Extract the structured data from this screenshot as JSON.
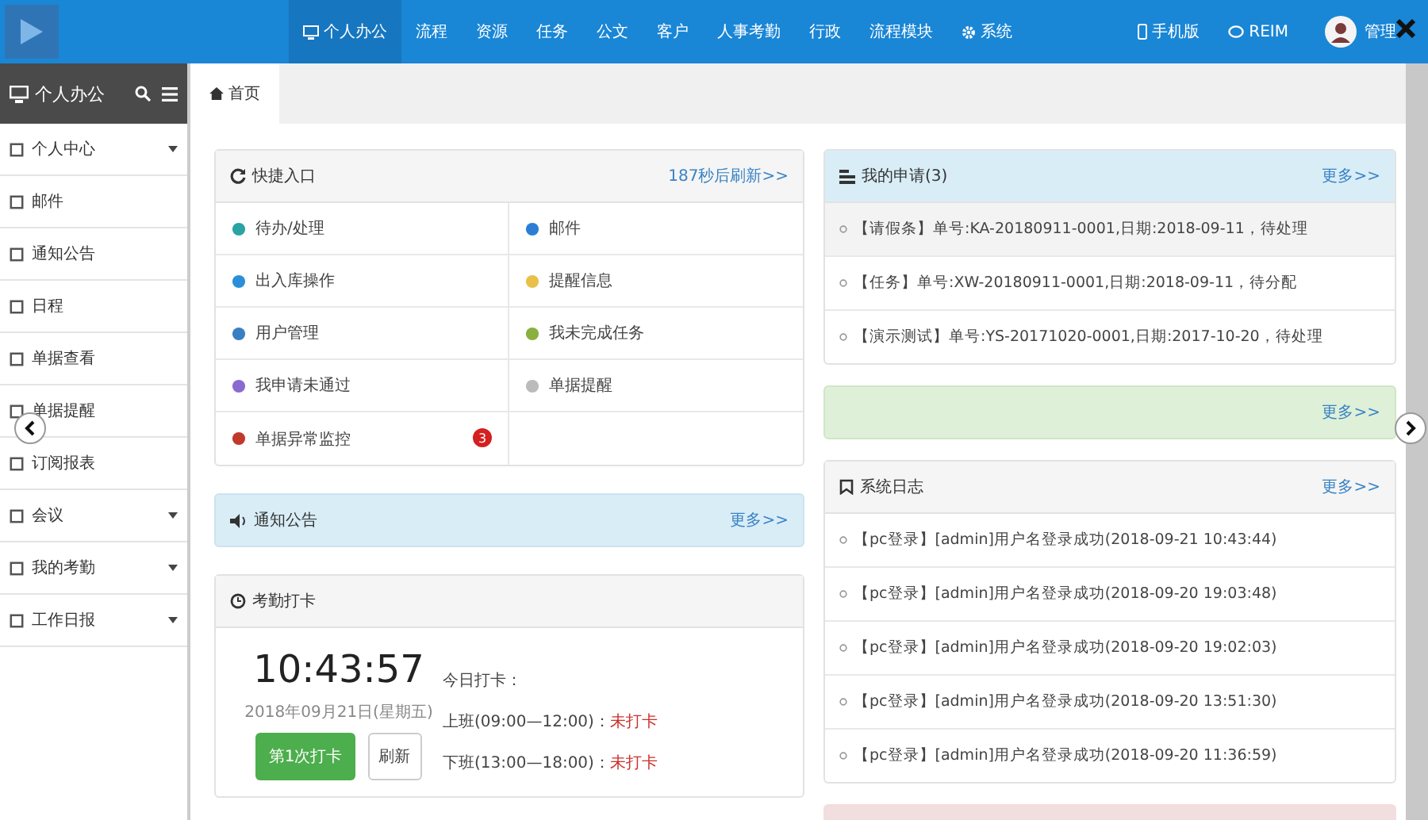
{
  "top_nav": {
    "items": [
      {
        "label": "个人办公",
        "selected": true
      },
      {
        "label": "流程",
        "selected": false
      },
      {
        "label": "资源",
        "selected": false
      },
      {
        "label": "任务",
        "selected": false
      },
      {
        "label": "公文",
        "selected": false
      },
      {
        "label": "客户",
        "selected": false
      },
      {
        "label": "人事考勤",
        "selected": false
      },
      {
        "label": "行政",
        "selected": false
      },
      {
        "label": "流程模块",
        "selected": false
      },
      {
        "label": "系统",
        "selected": false
      }
    ],
    "links": [
      "手机版",
      "REIM"
    ],
    "user": "管理"
  },
  "sidebar": {
    "title": "个人办公",
    "items": [
      {
        "label": "个人中心",
        "has_submenu": true
      },
      {
        "label": "邮件",
        "has_submenu": false
      },
      {
        "label": "通知公告",
        "has_submenu": false
      },
      {
        "label": "日程",
        "has_submenu": false
      },
      {
        "label": "单据查看",
        "has_submenu": false
      },
      {
        "label": "单据提醒",
        "has_submenu": false
      },
      {
        "label": "订阅报表",
        "has_submenu": false
      },
      {
        "label": "会议",
        "has_submenu": true
      },
      {
        "label": "我的考勤",
        "has_submenu": true
      },
      {
        "label": "工作日报",
        "has_submenu": true
      }
    ]
  },
  "tabs": [
    {
      "label": "首页",
      "selected": true
    }
  ],
  "quick_entry": {
    "title": "快捷入口",
    "refresh": "187秒后刷新>>",
    "cells": [
      {
        "label": "待办/处理"
      },
      {
        "label": "邮件"
      },
      {
        "label": "出入库操作"
      },
      {
        "label": "提醒信息"
      },
      {
        "label": "用户管理"
      },
      {
        "label": "我未完成任务"
      },
      {
        "label": "我申请未通过"
      },
      {
        "label": "单据提醒"
      },
      {
        "label": "单据异常监控",
        "badge": "3"
      }
    ]
  },
  "notice": {
    "title": "通知公告",
    "more": "更多>>"
  },
  "attendance": {
    "title": "考勤打卡",
    "time": "10:43:57",
    "date": "2018年09月21日(星期五)",
    "punch_button": "第1次打卡",
    "refresh_button": "刷新",
    "today_label": "今日打卡：",
    "shifts": [
      {
        "label": "上班(09:00—12:00)：",
        "status": "未打卡"
      },
      {
        "label": "下班(13:00—18:00)：",
        "status": "未打卡"
      }
    ]
  },
  "my_requests": {
    "title": "我的申请(3)",
    "more": "更多>>",
    "items": [
      "【请假条】单号:KA-20180911-0001,日期:2018-09-11，待处理",
      "【任务】单号:XW-20180911-0001,日期:2018-09-11，待分配",
      "【演示测试】单号:YS-20171020-0001,日期:2017-10-20，待处理"
    ]
  },
  "green_panel": {
    "more": "更多>>"
  },
  "system_log": {
    "title": "系统日志",
    "more": "更多>>",
    "items": [
      "【pc登录】[admin]用户名登录成功(2018-09-21 10:43:44)",
      "【pc登录】[admin]用户名登录成功(2018-09-20 19:03:48)",
      "【pc登录】[admin]用户名登录成功(2018-09-20 19:02:03)",
      "【pc登录】[admin]用户名登录成功(2018-09-20 13:51:30)",
      "【pc登录】[admin]用户名登录成功(2018-09-20 11:36:59)"
    ]
  }
}
